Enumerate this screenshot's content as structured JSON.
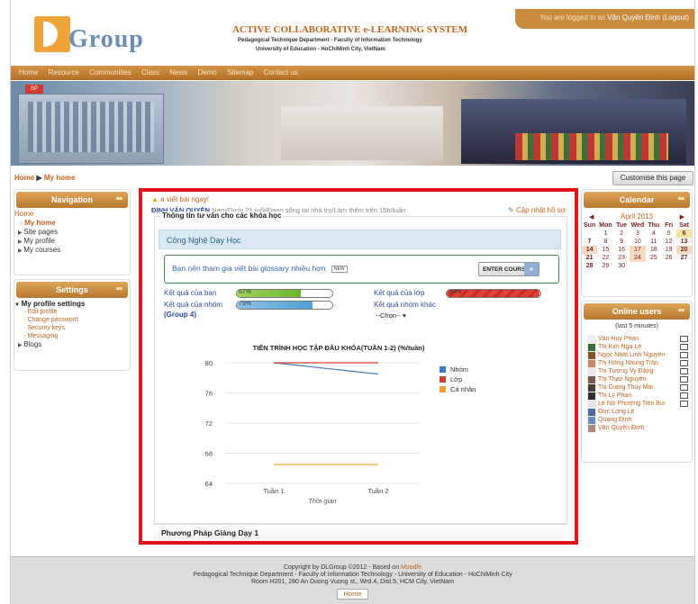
{
  "header": {
    "logo_text": "Group",
    "title": "ACTIVE COLLABORATIVE e-LEARNING SYSTEM",
    "department": "Pedagogical Technique Department - Faculty of Information Technology",
    "university": "University of Education - HoChiMinh City, VietNam",
    "login_prefix": "You are logged in as",
    "login_user": "Văn Quyền Đinh",
    "logout": "Logout"
  },
  "navbar": [
    "Home",
    "Resource",
    "Communities",
    "Class",
    "News",
    "Demo",
    "Sitemap",
    "Contact us"
  ],
  "breadcrumb": {
    "home": "Home",
    "current": "My home"
  },
  "customise_button": "Customise this page",
  "navigation": {
    "title": "Navigation",
    "home": "Home",
    "current": "My home",
    "items": [
      "Site pages",
      "My profile",
      "My courses"
    ]
  },
  "settings": {
    "title": "Settings",
    "head": "My profile settings",
    "subs": [
      "Edit profile",
      "Change password",
      "Security keys",
      "Messaging"
    ],
    "blogs": "Blogs"
  },
  "calendar": {
    "title": "Calendar",
    "month": "April 2013",
    "days": [
      "Sun",
      "Mon",
      "Tue",
      "Wed",
      "Thu",
      "Fri",
      "Sat"
    ],
    "weeks": [
      [
        "",
        "1",
        "2",
        "3",
        "4",
        "5",
        "6"
      ],
      [
        "7",
        "8",
        "9",
        "10",
        "11",
        "12",
        "13"
      ],
      [
        "14",
        "15",
        "16",
        "17",
        "18",
        "19",
        "20"
      ],
      [
        "21",
        "22",
        "23",
        "24",
        "25",
        "26",
        "27"
      ],
      [
        "28",
        "29",
        "30",
        "",
        "",
        "",
        ""
      ]
    ],
    "highlighted": [
      "14",
      "17",
      "20",
      "24"
    ],
    "today": "6"
  },
  "online_users": {
    "title": "Online users",
    "subtitle": "(last 5 minutes)",
    "users": [
      "Văn Huy Phan",
      "Thị Kim Nga Lê",
      "Ngọc Nhất Linh Nguyễn",
      "Thị Hồng Nhung Trần",
      "Thị Tường Vy Đặng",
      "Thị Thảo Nguyễn",
      "Thị Giang Thùy Mai",
      "Thị Ly Phan",
      "Lê Nữ Phượng Tiên Bùi",
      "Đức Long Lê",
      "Quang Đinh",
      "Văn Quyền Đinh"
    ]
  },
  "main": {
    "alert": "a viết bài ngay!",
    "status_name": "ĐINH VĂN QUYỀN",
    "status_text": "Nam/Dưới 25 tuổi/Đang sống tại nhà trọ/Làm thêm trên 15h/tuần",
    "update_profile": "Cập nhật hồ sơ",
    "advice_title": "Thông tin tư vấn cho các khóa học",
    "course_name": "Công Nghệ Dạy Học",
    "glossary_text": "Bạn nên tham gia viết bài glossary nhiều hơn",
    "new_badge": "NEW",
    "enter_course": "ENTER COURSE",
    "your_result": "Kết quả của bạn",
    "your_result_pct": "67%",
    "your_result_value": 67,
    "class_result": "Kết quả của lớp",
    "class_result_pct": "99%",
    "class_result_value": 99,
    "group_result": "Kết quả của nhóm",
    "group_result_pct": "79%",
    "group_result_value": 79,
    "group_name": "(Group 4)",
    "other_group": "Kết quả nhóm khác",
    "select_value": "--Chọn--",
    "section2": "Phương Pháp Giảng Dạy 1"
  },
  "chart_data": {
    "type": "line",
    "title": "TIẾN TRÌNH HỌC TẬP ĐẦU KHÓA(TUẦN 1-2) (%/tuần)",
    "xlabel": "Thời gian",
    "ylabel": "",
    "categories": [
      "Tuần 1",
      "Tuần 2"
    ],
    "ylim": [
      64,
      80
    ],
    "yticks": [
      64,
      68,
      72,
      76,
      80
    ],
    "legend_position": "right",
    "series": [
      {
        "name": "Nhóm",
        "values": [
          80,
          78.5
        ],
        "color": "#3a78c9"
      },
      {
        "name": "Lớp",
        "values": [
          80,
          80
        ],
        "color": "#d23b2f"
      },
      {
        "name": "Cá nhân",
        "values": [
          66.5,
          66.5
        ],
        "color": "#f0a02a"
      }
    ]
  },
  "footer": {
    "line1_prefix": "Copyright by DLGroup ©2012 - Based on",
    "moodle": "Moodle",
    "line2": "Pedagogical Technique Department - Faculty of Information Technology - University of Education - HoChiMinh City",
    "line3": "Room H201, 280 An Duong Vuong st., Wrd.4, Dist.5, HCM City, VietNam",
    "home": "Home"
  }
}
